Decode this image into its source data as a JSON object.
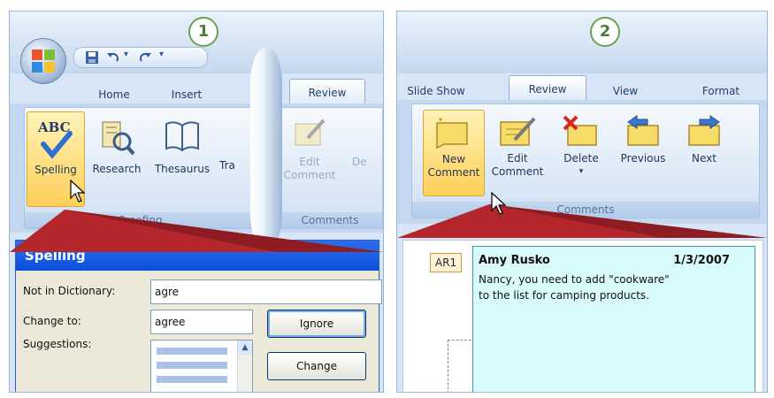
{
  "badges": {
    "panel1": "1",
    "panel2": "2"
  },
  "panel1": {
    "tabs": {
      "home": "Home",
      "insert": "Insert",
      "review": "Review"
    },
    "buttons": {
      "spelling": "Spelling",
      "research": "Research",
      "thesaurus": "Thesaurus",
      "translate_partial": "Tra",
      "edit_comment_line1": "Edit",
      "edit_comment_line2": "Comment",
      "delete_partial": "De"
    },
    "groups": {
      "proofing": "Proofing",
      "comments": "Comments"
    },
    "dialog": {
      "title": "Spelling",
      "not_in_dictionary_label": "Not in Dictionary:",
      "not_in_dictionary_value": "agre",
      "change_to_label": "Change to:",
      "change_to_value": "agree",
      "suggestions_label": "Suggestions:",
      "ignore_button": "Ignore",
      "change_button": "Change"
    }
  },
  "panel2": {
    "tabs": {
      "slide_show": "Slide Show",
      "review": "Review",
      "view": "View",
      "format": "Format"
    },
    "buttons": {
      "new_comment_line1": "New",
      "new_comment_line2": "Comment",
      "edit_comment_line1": "Edit",
      "edit_comment_line2": "Comment",
      "delete": "Delete",
      "previous": "Previous",
      "next": "Next"
    },
    "groups": {
      "comments": "Comments"
    },
    "comment": {
      "marker": "AR1",
      "author": "Amy Rusko",
      "date": "1/3/2007",
      "text_line1": "Nancy, you need to add \"cookware\"",
      "text_line2": "to the list for camping products."
    }
  },
  "colors": {
    "ribbon_background": "#d7e5f6",
    "highlight": "#ffcf59",
    "badge_border": "#6aa34f",
    "dialog_title": "#0a4fd8",
    "comment_background": "#d9fbfb",
    "callout_red": "#b3262c"
  },
  "icons": {
    "office_button": "office-logo-icon",
    "save": "save-icon",
    "undo": "undo-icon",
    "redo": "redo-icon",
    "spelling": "abc-check-icon",
    "research": "research-icon",
    "thesaurus": "book-icon",
    "new_comment": "new-comment-icon",
    "edit_comment": "edit-comment-icon",
    "delete": "delete-comment-icon",
    "previous": "previous-comment-icon",
    "next": "next-comment-icon",
    "cursor": "mouse-pointer-icon"
  }
}
